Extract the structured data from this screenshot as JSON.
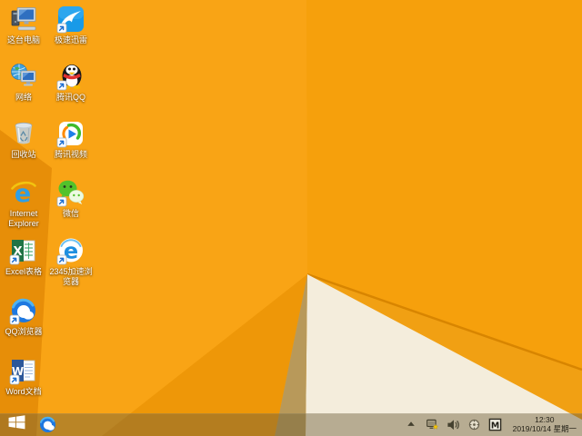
{
  "wallpaper": {
    "main": "#F9A415",
    "right_panel": "#F6A00C",
    "left_fold": "#E78E08",
    "lower_left_fold": "#EE9708",
    "tan_wedge": "#B8995A",
    "cream_panel": "#F4EDDC",
    "right_band": "#F1A013",
    "fold_edge_line": "#D88500"
  },
  "desktop": {
    "icons": [
      {
        "id": "this-pc",
        "label": "这台电脑",
        "col": 0,
        "row": 0
      },
      {
        "id": "xunlei",
        "label": "极速迅雷",
        "col": 1,
        "row": 0
      },
      {
        "id": "network",
        "label": "网络",
        "col": 0,
        "row": 1
      },
      {
        "id": "tencent-qq",
        "label": "腾讯QQ",
        "col": 1,
        "row": 1
      },
      {
        "id": "recycle-bin",
        "label": "回收站",
        "col": 0,
        "row": 2
      },
      {
        "id": "tencent-video",
        "label": "腾讯视频",
        "col": 1,
        "row": 2
      },
      {
        "id": "internet-explorer",
        "label": "Internet Explorer",
        "col": 0,
        "row": 3
      },
      {
        "id": "wechat",
        "label": "微信",
        "col": 1,
        "row": 3
      },
      {
        "id": "excel",
        "label": "Excel表格",
        "col": 0,
        "row": 4
      },
      {
        "id": "browser-2345",
        "label": "2345加速浏览器",
        "col": 1,
        "row": 4
      },
      {
        "id": "qq-browser",
        "label": "QQ浏览器",
        "col": 0,
        "row": 5
      },
      {
        "id": "word",
        "label": "Word文档",
        "col": 0,
        "row": 6
      }
    ]
  },
  "taskbar": {
    "pinned": [
      "qq-browser"
    ],
    "tray": {
      "icons": [
        "hidden-icons-arrow",
        "network-status",
        "volume",
        "input-indicator",
        "ime-mode"
      ],
      "ime_letter": "M",
      "clock_time": "12:30",
      "clock_date": "2019/10/14 星期一"
    }
  }
}
